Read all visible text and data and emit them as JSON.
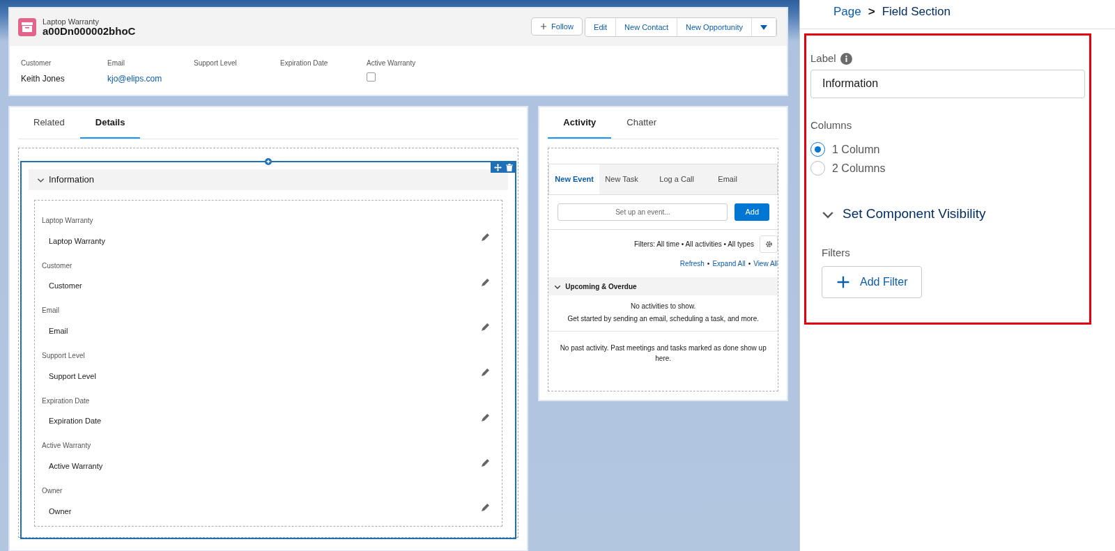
{
  "record_header": {
    "object_type": "Laptop Warranty",
    "record_name": "a00Dn000002bhoC",
    "follow_button": "Follow",
    "actions": [
      "Edit",
      "New Contact",
      "New Opportunity"
    ]
  },
  "highlights": [
    {
      "label": "Customer",
      "value": "Keith Jones",
      "kind": "text"
    },
    {
      "label": "Email",
      "value": "kjo@elips.com",
      "kind": "link"
    },
    {
      "label": "Support Level",
      "kind": "text"
    },
    {
      "label": "Expiration Date",
      "kind": "text"
    },
    {
      "label": "Active Warranty",
      "kind": "checkbox",
      "checked": false
    }
  ],
  "main_tabs": [
    {
      "label": "Related",
      "selected": false
    },
    {
      "label": "Details",
      "selected": true
    }
  ],
  "section": {
    "title": "Information",
    "expanded": true,
    "fields": [
      {
        "label": "Laptop Warranty",
        "value": "Laptop Warranty"
      },
      {
        "label": "Customer",
        "value": "Customer"
      },
      {
        "label": "Email",
        "value": "Email"
      },
      {
        "label": "Support Level",
        "value": "Support Level"
      },
      {
        "label": "Expiration Date",
        "value": "Expiration Date"
      },
      {
        "label": "Active Warranty",
        "value": "Active Warranty"
      },
      {
        "label": "Owner",
        "value": "Owner"
      }
    ]
  },
  "activity_tabs": [
    {
      "label": "Activity",
      "selected": true
    },
    {
      "label": "Chatter",
      "selected": false
    }
  ],
  "composer_tabs": [
    {
      "label": "New Event",
      "selected": true
    },
    {
      "label": "New Task",
      "selected": false
    },
    {
      "label": "Log a Call",
      "selected": false
    },
    {
      "label": "Email",
      "selected": false
    }
  ],
  "composer": {
    "placeholder": "Set up an event...",
    "button": "Add"
  },
  "filters": {
    "text": "Filters: All time • All activities • All types",
    "links": [
      "Refresh",
      "Expand All",
      "View All"
    ],
    "separator": "•"
  },
  "upcoming": {
    "title": "Upcoming & Overdue",
    "expanded": true,
    "messages": [
      "No activities to show.",
      "Get started by sending an email, scheduling a task, and more."
    ]
  },
  "past_message": "No past activity. Past meetings and tasks marked as done show up here.",
  "properties": {
    "breadcrumb": [
      "Page",
      "Field Section"
    ],
    "separator": ">",
    "label_field": {
      "label": "Label",
      "value": "Information"
    },
    "columns": {
      "label": "Columns",
      "options": [
        {
          "label": "1 Column",
          "selected": true
        },
        {
          "label": "2 Columns",
          "selected": false
        }
      ]
    },
    "visibility": {
      "title": "Set Component Visibility",
      "expanded": true,
      "filters_label": "Filters",
      "button": "Add Filter"
    }
  }
}
